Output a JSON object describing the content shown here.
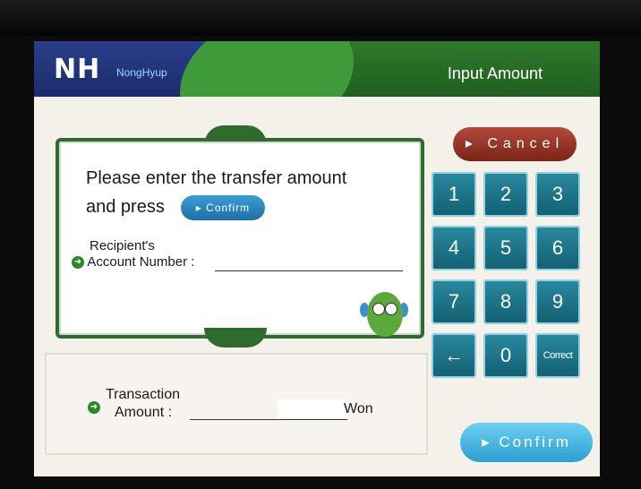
{
  "header": {
    "logo": "NH",
    "logo_sub": "NongHyup",
    "title": "Input Amount"
  },
  "instruction": {
    "line1": "Please enter the transfer amount",
    "line2_prefix": "and press",
    "confirm_label": "Confirm",
    "recipient_label_line1": "Recipient's",
    "recipient_label_line2": "Account Number :"
  },
  "keypad": {
    "cancel_label": "Cancel",
    "keys": [
      "1",
      "2",
      "3",
      "4",
      "5",
      "6",
      "7",
      "8",
      "9",
      "←",
      "0",
      "Correct"
    ]
  },
  "amount": {
    "label_line1": "Transaction",
    "label_line2": "Amount :",
    "unit": "Won"
  },
  "confirm_button": "Confirm",
  "colors": {
    "header_green": "#2f7a2c",
    "key_teal": "#2a8aa0",
    "cancel_red": "#9e3a2c",
    "confirm_blue": "#3aaee0"
  }
}
